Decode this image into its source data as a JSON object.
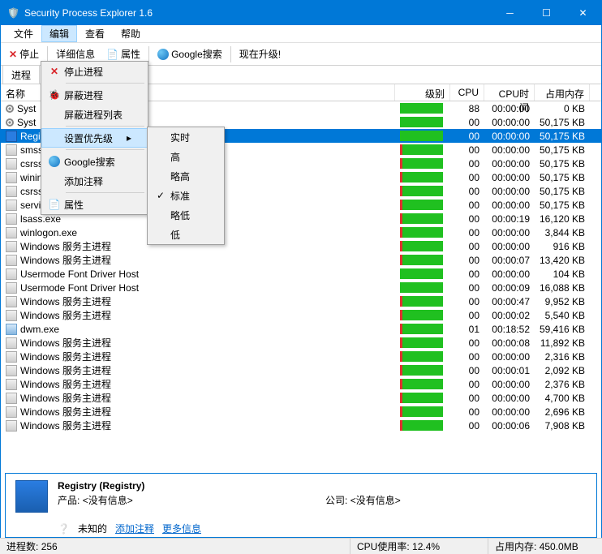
{
  "window": {
    "title": "Security Process Explorer 1.6"
  },
  "menubar": {
    "file": "文件",
    "edit": "编辑",
    "view": "查看",
    "help": "帮助"
  },
  "toolbar": {
    "stop": "停止",
    "detail": "详细信息",
    "properties": "属性",
    "google": "Google搜索",
    "upgrade": "现在升级!"
  },
  "tab": {
    "processes": "进程"
  },
  "columns": {
    "name": "名称",
    "level": "级别",
    "cpu": "CPU",
    "cputime": "CPU时间",
    "mem": "占用内存"
  },
  "ctx": {
    "stop_process": "停止进程",
    "block_process": "屏蔽进程",
    "block_list": "屏蔽进程列表",
    "set_priority": "设置优先级",
    "google": "Google搜索",
    "add_comment": "添加注释",
    "properties": "属性"
  },
  "priority": {
    "realtime": "实时",
    "high": "高",
    "above": "略高",
    "normal": "标准",
    "below": "略低",
    "low": "低"
  },
  "rows": [
    {
      "name": "Syst",
      "red": 0,
      "green": 95,
      "cpu": "88",
      "cputime": "00:00:00",
      "mem": "0 KB",
      "ico": "gear"
    },
    {
      "name": "Syst",
      "red": 0,
      "green": 95,
      "cpu": "00",
      "cputime": "00:00:00",
      "mem": "50,175 KB",
      "ico": "gear"
    },
    {
      "name": "Regi",
      "red": 0,
      "green": 95,
      "cpu": "00",
      "cputime": "00:00:00",
      "mem": "50,175 KB",
      "ico": "reg",
      "sel": true
    },
    {
      "name": "smss",
      "red": 5,
      "green": 90,
      "cpu": "00",
      "cputime": "00:00:00",
      "mem": "50,175 KB",
      "ico": "svc"
    },
    {
      "name": "csrss",
      "red": 5,
      "green": 90,
      "cpu": "00",
      "cputime": "00:00:00",
      "mem": "50,175 KB",
      "ico": "svc"
    },
    {
      "name": "winin",
      "red": 5,
      "green": 90,
      "cpu": "00",
      "cputime": "00:00:00",
      "mem": "50,175 KB",
      "ico": "svc"
    },
    {
      "name": "csrss",
      "red": 5,
      "green": 90,
      "cpu": "00",
      "cputime": "00:00:00",
      "mem": "50,175 KB",
      "ico": "svc"
    },
    {
      "name": "services.exe",
      "red": 5,
      "green": 90,
      "cpu": "00",
      "cputime": "00:00:00",
      "mem": "50,175 KB",
      "ico": "svc"
    },
    {
      "name": "lsass.exe",
      "red": 5,
      "green": 90,
      "cpu": "00",
      "cputime": "00:00:19",
      "mem": "16,120 KB",
      "ico": "svc"
    },
    {
      "name": "winlogon.exe",
      "red": 5,
      "green": 90,
      "cpu": "00",
      "cputime": "00:00:00",
      "mem": "3,844 KB",
      "ico": "svc"
    },
    {
      "name": "Windows 服务主进程",
      "red": 5,
      "green": 90,
      "cpu": "00",
      "cputime": "00:00:00",
      "mem": "916 KB",
      "ico": "svc"
    },
    {
      "name": "Windows 服务主进程",
      "red": 5,
      "green": 90,
      "cpu": "00",
      "cputime": "00:00:07",
      "mem": "13,420 KB",
      "ico": "svc"
    },
    {
      "name": "Usermode Font Driver Host",
      "red": 0,
      "green": 95,
      "cpu": "00",
      "cputime": "00:00:00",
      "mem": "104 KB",
      "ico": "svc"
    },
    {
      "name": "Usermode Font Driver Host",
      "red": 0,
      "green": 95,
      "cpu": "00",
      "cputime": "00:00:09",
      "mem": "16,088 KB",
      "ico": "svc"
    },
    {
      "name": "Windows 服务主进程",
      "red": 5,
      "green": 90,
      "cpu": "00",
      "cputime": "00:00:47",
      "mem": "9,952 KB",
      "ico": "svc"
    },
    {
      "name": "Windows 服务主进程",
      "red": 5,
      "green": 90,
      "cpu": "00",
      "cputime": "00:00:02",
      "mem": "5,540 KB",
      "ico": "svc"
    },
    {
      "name": "dwm.exe",
      "red": 5,
      "green": 90,
      "cpu": "01",
      "cputime": "00:18:52",
      "mem": "59,416 KB",
      "ico": "app"
    },
    {
      "name": "Windows 服务主进程",
      "red": 5,
      "green": 90,
      "cpu": "00",
      "cputime": "00:00:08",
      "mem": "11,892 KB",
      "ico": "svc"
    },
    {
      "name": "Windows 服务主进程",
      "red": 5,
      "green": 90,
      "cpu": "00",
      "cputime": "00:00:00",
      "mem": "2,316 KB",
      "ico": "svc"
    },
    {
      "name": "Windows 服务主进程",
      "red": 5,
      "green": 90,
      "cpu": "00",
      "cputime": "00:00:01",
      "mem": "2,092 KB",
      "ico": "svc"
    },
    {
      "name": "Windows 服务主进程",
      "red": 5,
      "green": 90,
      "cpu": "00",
      "cputime": "00:00:00",
      "mem": "2,376 KB",
      "ico": "svc"
    },
    {
      "name": "Windows 服务主进程",
      "red": 5,
      "green": 90,
      "cpu": "00",
      "cputime": "00:00:00",
      "mem": "4,700 KB",
      "ico": "svc"
    },
    {
      "name": "Windows 服务主进程",
      "red": 5,
      "green": 90,
      "cpu": "00",
      "cputime": "00:00:00",
      "mem": "2,696 KB",
      "ico": "svc"
    },
    {
      "name": "Windows 服务主进程",
      "red": 5,
      "green": 90,
      "cpu": "00",
      "cputime": "00:00:06",
      "mem": "7,908 KB",
      "ico": "svc"
    }
  ],
  "info": {
    "title": "Registry (Registry)",
    "product_label": "产品:",
    "product_value": "<没有信息>",
    "company_label": "公司:",
    "company_value": "<没有信息>",
    "unknown": "未知的",
    "add_comment": "添加注释",
    "more_info": "更多信息"
  },
  "status": {
    "procs_label": "进程数:",
    "procs_value": "256",
    "cpu_label": "CPU使用率:",
    "cpu_value": "12.4%",
    "mem_label": "占用内存:",
    "mem_value": "450.0MB"
  }
}
